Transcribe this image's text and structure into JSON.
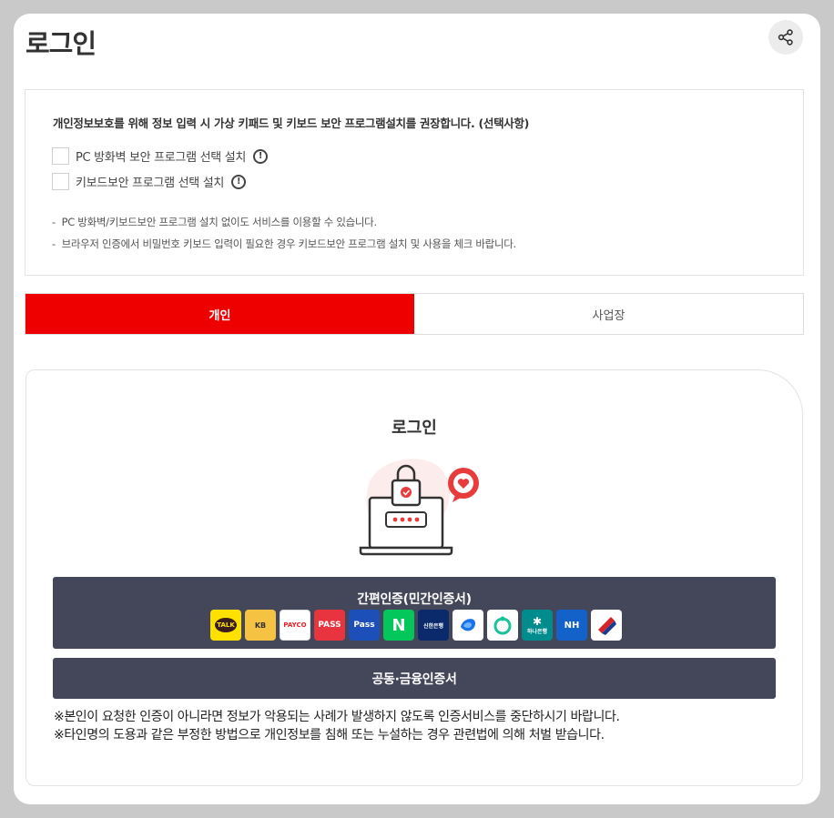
{
  "header": {
    "title": "로그인",
    "share_icon": "share-icon"
  },
  "notice": {
    "heading": "개인정보보호를 위해 정보 입력 시 가상 키패드 및 키보드 보안 프로그램설치를 권장합니다. (선택사항)",
    "checkboxes": [
      {
        "label": "PC 방화벽 보안 프로그램 선택 설치",
        "checked": false,
        "info_icon": "info-icon"
      },
      {
        "label": "키보드보안 프로그램 선택 설치",
        "checked": false,
        "info_icon": "info-icon"
      }
    ],
    "bullets": [
      "PC 방화벽/키보드보안 프로그램 설치 없이도 서비스를 이용할 수 있습니다.",
      "브라우저 인증에서 비밀번호 키보드 입력이 필요한 경우 키보드보안 프로그램 설치 및 사용을 체크 바랍니다."
    ]
  },
  "tabs": [
    {
      "label": "개인",
      "active": true
    },
    {
      "label": "사업장",
      "active": false
    }
  ],
  "login": {
    "heading": "로그인",
    "illustration": "laptop-lock-icon",
    "simple_auth": {
      "label": "간편인증(민간인증서)",
      "providers": [
        {
          "name": "kakao",
          "text": "TALK",
          "bg": "#ffe100",
          "fg": "#3a1d1d"
        },
        {
          "name": "kb",
          "text": "KB",
          "bg": "#f5c242",
          "fg": "#333333"
        },
        {
          "name": "payco",
          "text": "PAYCO",
          "bg": "#ffffff",
          "fg": "#ee1c25"
        },
        {
          "name": "pass",
          "text": "PASS",
          "bg": "#e8343f",
          "fg": "#ffffff"
        },
        {
          "name": "samsung-pass",
          "text": "Pass",
          "bg": "#1d4fb8",
          "fg": "#ffffff"
        },
        {
          "name": "naver",
          "text": "N",
          "bg": "#03c75a",
          "fg": "#ffffff"
        },
        {
          "name": "shinhan",
          "text": "신한은행",
          "bg": "#0a2a6b",
          "fg": "#ffffff"
        },
        {
          "name": "toss",
          "text": "",
          "bg": "#ffffff",
          "fg": "#1a73e8"
        },
        {
          "name": "banksalad",
          "text": "",
          "bg": "#ffffff",
          "fg": "#1cc29a"
        },
        {
          "name": "hana",
          "text": "하나은행",
          "bg": "#008c8c",
          "fg": "#ffffff"
        },
        {
          "name": "nh",
          "text": "NH",
          "bg": "#1262c9",
          "fg": "#ffffff"
        },
        {
          "name": "ibk",
          "text": "",
          "bg": "#ffffff",
          "fg": "#d6232a"
        }
      ]
    },
    "cert_button": "공동·금융인증서",
    "warnings": [
      "※본인이 요청한 인증이 아니라면 정보가 악용되는 사례가 발생하지 않도록 인증서비스를 중단하시기 바랍니다.",
      "※타인명의 도용과 같은 부정한 방법으로 개인정보를 침해 또는 누설하는 경우 관련법에 의해 처벌 받습니다."
    ]
  },
  "colors": {
    "accent": "#ee0000",
    "button_dark": "#44465a",
    "background": "#c9c9c9"
  }
}
